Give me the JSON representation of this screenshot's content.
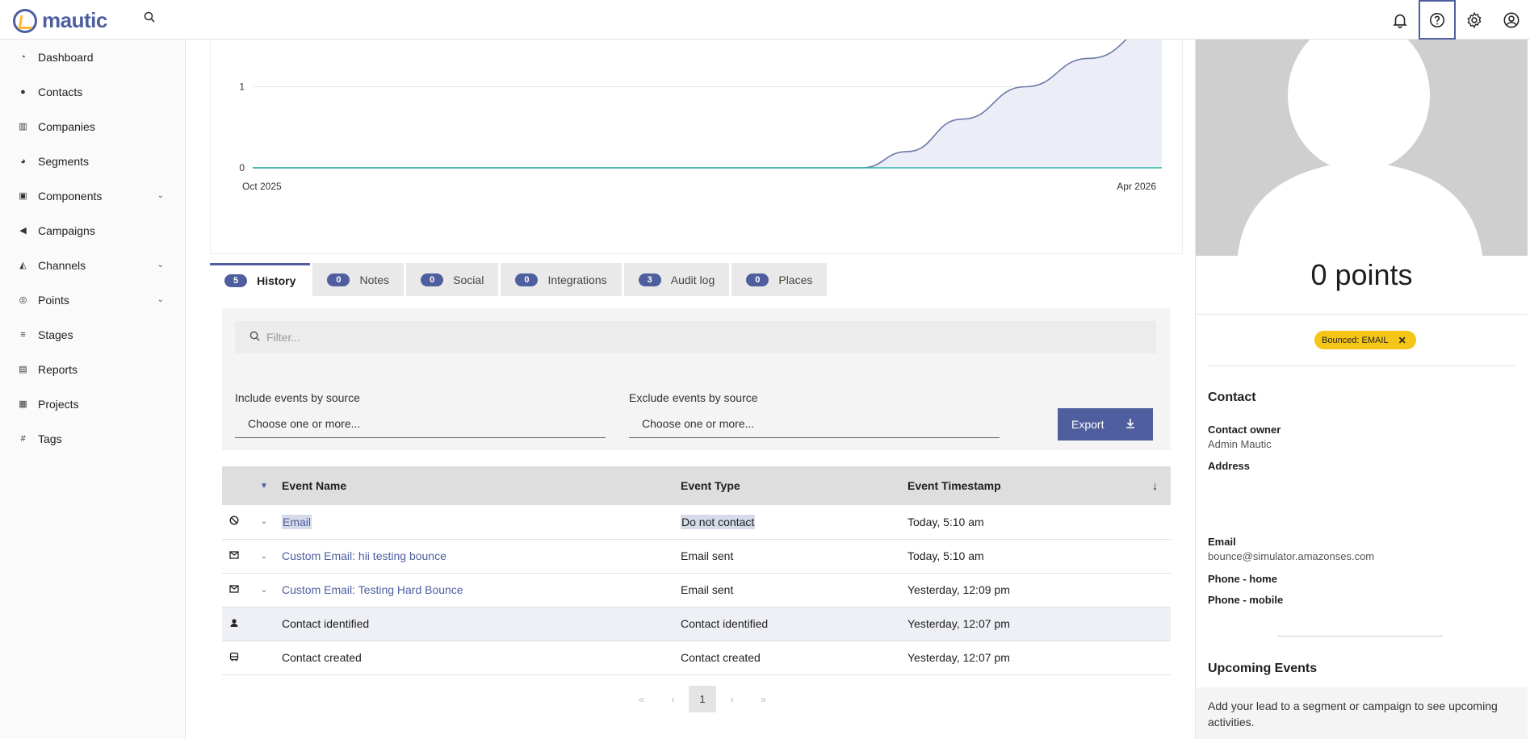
{
  "app": {
    "logo_text": "mautic"
  },
  "sidebar": {
    "items": [
      {
        "label": "Dashboard",
        "icon": "dashboard-icon",
        "has_caret": false
      },
      {
        "label": "Contacts",
        "icon": "contacts-icon",
        "has_caret": false
      },
      {
        "label": "Companies",
        "icon": "companies-icon",
        "has_caret": false
      },
      {
        "label": "Segments",
        "icon": "segments-icon",
        "has_caret": false
      },
      {
        "label": "Components",
        "icon": "components-icon",
        "has_caret": true
      },
      {
        "label": "Campaigns",
        "icon": "campaigns-icon",
        "has_caret": false
      },
      {
        "label": "Channels",
        "icon": "channels-icon",
        "has_caret": true
      },
      {
        "label": "Points",
        "icon": "points-icon",
        "has_caret": true
      },
      {
        "label": "Stages",
        "icon": "stages-icon",
        "has_caret": false
      },
      {
        "label": "Reports",
        "icon": "reports-icon",
        "has_caret": false
      },
      {
        "label": "Projects",
        "icon": "projects-icon",
        "has_caret": false
      },
      {
        "label": "Tags",
        "icon": "tags-icon",
        "has_caret": false
      }
    ]
  },
  "chart_data": {
    "type": "line",
    "x_tick_labels": [
      "Oct 2025",
      "Apr 2026"
    ],
    "y_tick_labels": [
      "0",
      "1"
    ],
    "ylim": [
      0,
      2
    ],
    "series": [
      {
        "color": "#6d79a8",
        "fill": "#eceef7",
        "x": [
          0,
          0.67,
          0.72,
          0.78,
          0.85,
          0.92,
          1.0
        ],
        "values": [
          0,
          0,
          0.2,
          0.6,
          1.0,
          1.35,
          1.8
        ]
      },
      {
        "color": "#2bb5a8",
        "fill": "none",
        "x": [
          0,
          1.0
        ],
        "values": [
          0,
          0
        ]
      }
    ]
  },
  "tabs": [
    {
      "count": "5",
      "label": "History",
      "active": true
    },
    {
      "count": "0",
      "label": "Notes",
      "active": false
    },
    {
      "count": "0",
      "label": "Social",
      "active": false
    },
    {
      "count": "0",
      "label": "Integrations",
      "active": false
    },
    {
      "count": "3",
      "label": "Audit log",
      "active": false
    },
    {
      "count": "0",
      "label": "Places",
      "active": false
    }
  ],
  "filters": {
    "search_placeholder": "Filter...",
    "include_label": "Include events by source",
    "include_placeholder": "Choose one or more...",
    "exclude_label": "Exclude events by source",
    "exclude_placeholder": "Choose one or more...",
    "export_label": "Export"
  },
  "table": {
    "headers": {
      "name": "Event Name",
      "type": "Event Type",
      "timestamp": "Event Timestamp"
    },
    "rows": [
      {
        "icon": "ban-icon",
        "expandable": true,
        "name": "Email",
        "type": "Do not contact",
        "time": "Today, 5:10 am"
      },
      {
        "icon": "email-sent-icon",
        "expandable": true,
        "name": "Custom Email: hii testing bounce",
        "type": "Email sent",
        "time": "Today, 5:10 am"
      },
      {
        "icon": "email-sent-icon",
        "expandable": true,
        "name": "Custom Email: Testing Hard Bounce",
        "type": "Email sent",
        "time": "Yesterday, 12:09 pm"
      },
      {
        "icon": "user-icon",
        "expandable": false,
        "name": "Contact identified",
        "type": "Contact identified",
        "time": "Yesterday, 12:07 pm"
      },
      {
        "icon": "contact-created-icon",
        "expandable": false,
        "name": "Contact created",
        "type": "Contact created",
        "time": "Yesterday, 12:07 pm"
      }
    ]
  },
  "pagination": {
    "current_page": "1",
    "first": "«",
    "prev": "‹",
    "next": "›",
    "last": "»"
  },
  "contact": {
    "points": "0 points",
    "tag": "Bounced: EMAIL",
    "tag_color": "#f5c518",
    "section_title": "Contact",
    "owner_label": "Contact owner",
    "owner_value": "Admin Mautic",
    "address_label": "Address",
    "email_label": "Email",
    "email_value": "bounce@simulator.amazonses.com",
    "phone_home_label": "Phone - home",
    "phone_mobile_label": "Phone - mobile",
    "upcoming_title": "Upcoming Events",
    "upcoming_text": "Add your lead to a segment or campaign to see upcoming activities."
  },
  "colors": {
    "accent": "#4e5e9e",
    "tag_yellow": "#f5c518",
    "teal_series": "#2bb5a8"
  }
}
